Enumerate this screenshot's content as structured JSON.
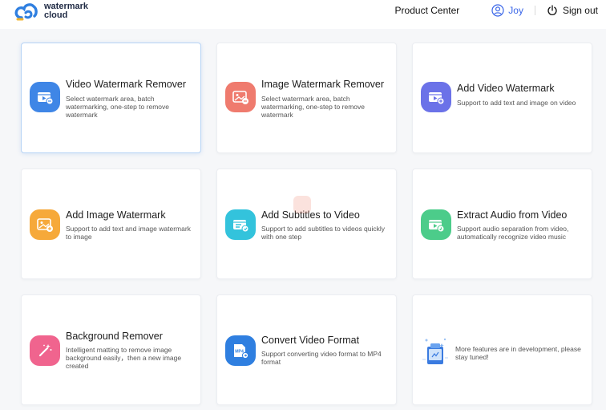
{
  "header": {
    "logo_line1": "watermark",
    "logo_line2": "cloud",
    "product_center": "Product Center",
    "user_name": "Joy",
    "sign_out": "Sign out"
  },
  "cards": [
    {
      "title": "Video Watermark Remover",
      "desc": "Select watermark area, batch watermarking, one-step to remove watermark",
      "icon": "video-eraser-icon",
      "color": "#3f86e6"
    },
    {
      "title": "Image Watermark Remover",
      "desc": "Select watermark area, batch watermarking, one-step to remove watermark",
      "icon": "image-eraser-icon",
      "color": "#ef7b6e"
    },
    {
      "title": "Add Video Watermark",
      "desc": "Support to add text and image on video",
      "icon": "video-add-icon",
      "color": "#6b72e8"
    },
    {
      "title": "Add Image Watermark",
      "desc": "Support to add text and image watermark to image",
      "icon": "image-add-icon",
      "color": "#f6a93a"
    },
    {
      "title": "Add Subtitles to Video",
      "desc": "Support to add subtitles to videos quickly with one step",
      "icon": "subtitle-icon",
      "color": "#33c3dc"
    },
    {
      "title": "Extract Audio from Video",
      "desc": "Support audio separation from video, automatically recognize video music",
      "icon": "audio-extract-icon",
      "color": "#4ccc8a"
    },
    {
      "title": "Background Remover",
      "desc": "Intelligent matting to remove image background easily，then a new image created",
      "icon": "magic-wand-icon",
      "color": "#f0648e"
    },
    {
      "title": "Convert Video Format",
      "desc": "Support converting video format to MP4 format",
      "icon": "mp4-convert-icon",
      "color": "#2f7fe0",
      "badge": "MP4"
    },
    {
      "title": "",
      "desc": "More features are in development, please stay tuned!",
      "icon": "development-illustration-icon",
      "color": "#3a7be0"
    }
  ]
}
